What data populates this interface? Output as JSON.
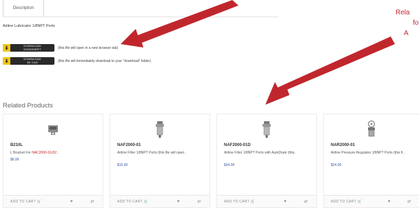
{
  "tabs": [
    {
      "label": "Description"
    }
  ],
  "description": {
    "text": "Airline Lubricator 1/8NPT Ports"
  },
  "downloads": [
    {
      "button_line1": "DOWNLOAD",
      "button_line2": "DATASHEET",
      "note": "(this file will open in a new browser tab)"
    },
    {
      "button_line1": "DOWNLOAD",
      "button_line2": "3D CAD",
      "note": "(this file will immediately download to your \"download\" folder)"
    }
  ],
  "related": {
    "title": "Related Products",
    "products": [
      {
        "name": "B210L",
        "description_prefix": "L Bracket For ",
        "description_link": "NAC2000-01/02..",
        "price": "$6.99",
        "add_to_cart": "ADD TO CART"
      },
      {
        "name": "NAF2000-01",
        "description": "Airline Filter 1/8NPT Ports (this file will open..",
        "price": "$15.00",
        "add_to_cart": "ADD TO CART"
      },
      {
        "name": "NAF2000-01D",
        "description": "Airline Filter 1/8NPT Ports with AutoDrain (this..",
        "price": "$34.00",
        "add_to_cart": "ADD TO CART"
      },
      {
        "name": "NAR2000-01",
        "description": "Airline Pressure Regulator 1/8NPT Ports (this fi..",
        "price": "$24.00",
        "add_to_cart": "ADD TO CART"
      }
    ]
  },
  "annotation": {
    "lines": [
      "Rela",
      "fo",
      "A"
    ],
    "color": "#c0272d"
  },
  "icons": {
    "download": "download-arrow-icon",
    "cart": "cart-icon",
    "wishlist": "heart-icon",
    "compare": "compare-icon"
  }
}
